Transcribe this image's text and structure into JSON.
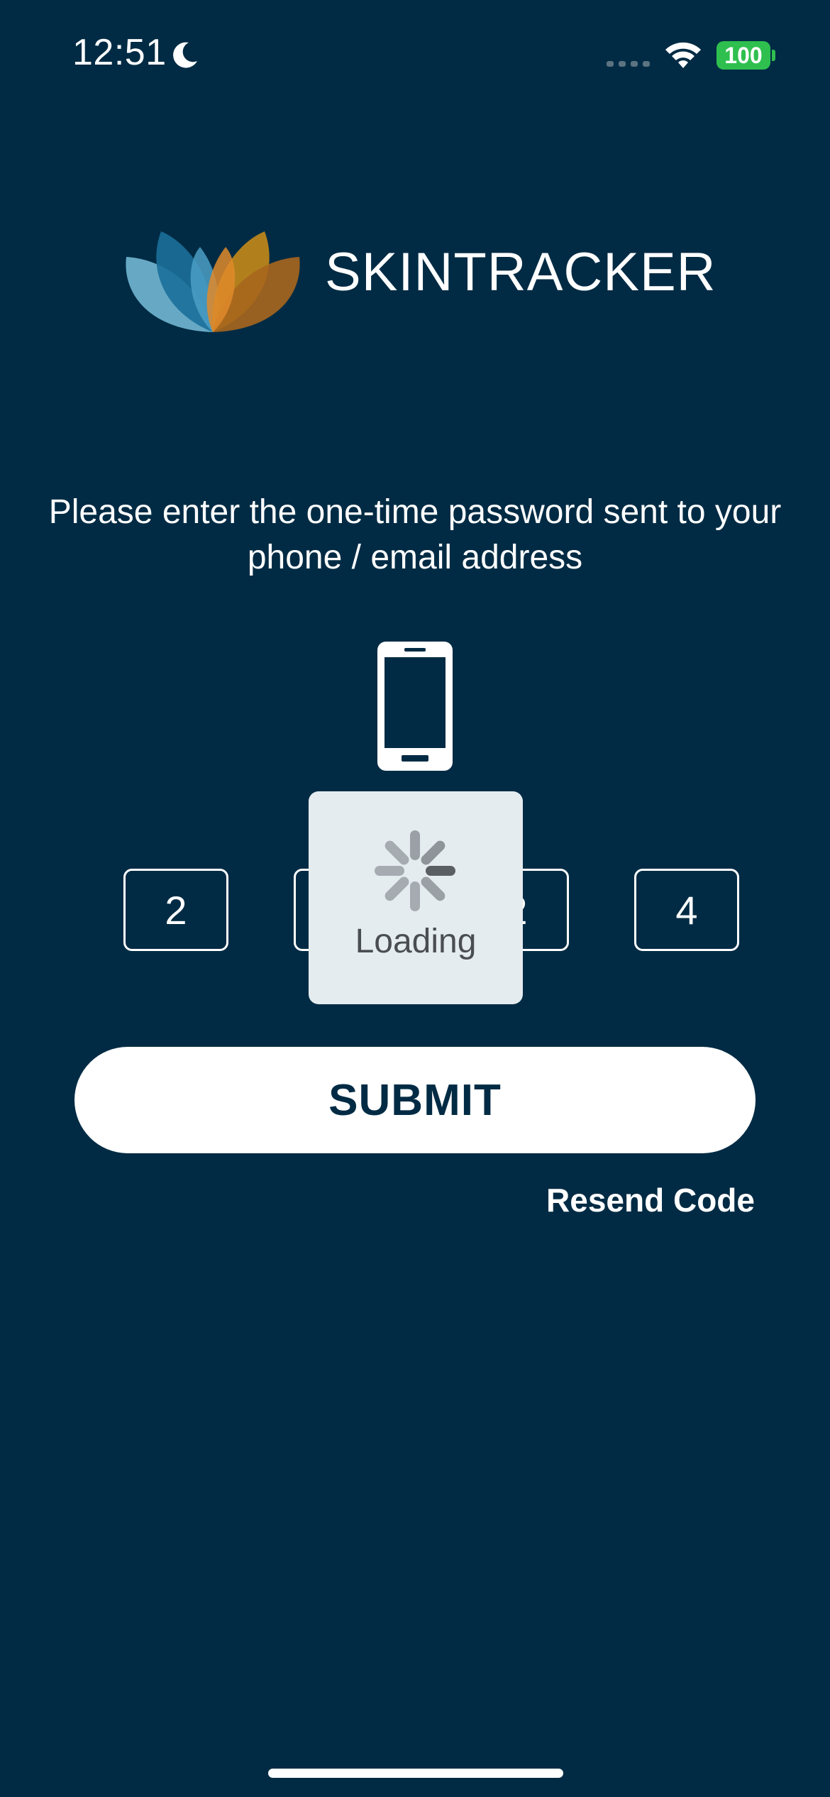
{
  "status_bar": {
    "time": "12:51",
    "battery": "100",
    "icons": [
      "moon-icon",
      "cellular-signal-icon",
      "wifi-icon",
      "battery-icon"
    ]
  },
  "brand": {
    "name": "SKINTRACKER",
    "logo_colors": [
      "#1b6f9a",
      "#4b9fc4",
      "#79c0dc",
      "#c48a1a",
      "#e08a2a",
      "#a8661e"
    ]
  },
  "instruction": "Please enter the one-time password sent to your phone / email address",
  "otp": {
    "icon": "smartphone-icon",
    "digits": [
      "2",
      "",
      "2",
      "4"
    ]
  },
  "loading": {
    "label": "Loading",
    "icon": "spinner-icon"
  },
  "submit_label": "SUBMIT",
  "resend_label": "Resend Code",
  "colors": {
    "background": "#012b44",
    "primary_text": "#ffffff",
    "battery": "#2fbf4f",
    "overlay": "#e5ecef"
  }
}
